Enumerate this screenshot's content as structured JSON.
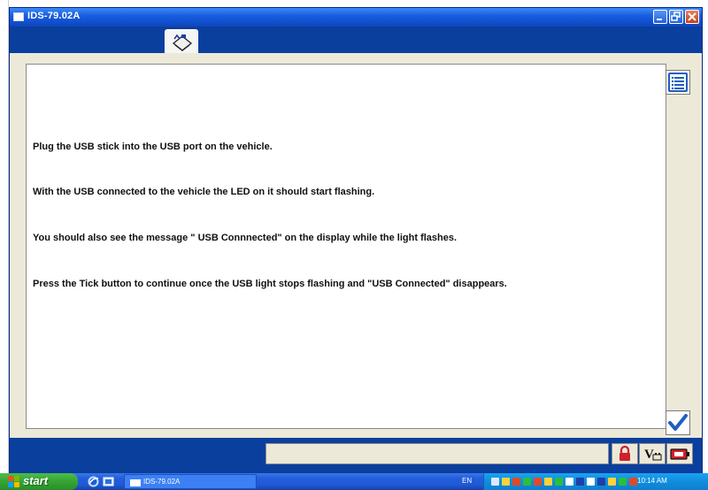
{
  "window": {
    "title": "IDS-79.02A",
    "buttons": {
      "minimize": "_",
      "maximize": "🗗",
      "close": "X"
    }
  },
  "tabs": [
    {
      "icon": "vehicle-book-icon",
      "active": true
    }
  ],
  "content": {
    "messages": [
      "Plug the USB stick into the USB port on the vehicle.",
      "With the USB connected to the vehicle the LED on it should start flashing.",
      "You should also see the message \" USB Connnected\" on the display while the light flashes.",
      "Press the Tick button to continue once the USB light stops flashing and \"USB Connected\" disappears."
    ]
  },
  "side_buttons": {
    "list": {
      "icon": "list-icon"
    },
    "tick": {
      "icon": "tick-icon"
    }
  },
  "status_bar": {
    "field_text": "",
    "icons": [
      "lock-icon",
      "voltage-battery-icon",
      "battery-icon"
    ]
  },
  "taskbar": {
    "start_label": "start",
    "task_button_label": "IDS-79.02A",
    "language": "EN",
    "clock": "10:14 AM"
  },
  "colors": {
    "window_blue": "#0a3f9e",
    "titlebar_blue": "#1a5fe0",
    "client_bg": "#ece9d8",
    "tick_blue": "#1f5fbf",
    "lock_red": "#d0202a"
  }
}
